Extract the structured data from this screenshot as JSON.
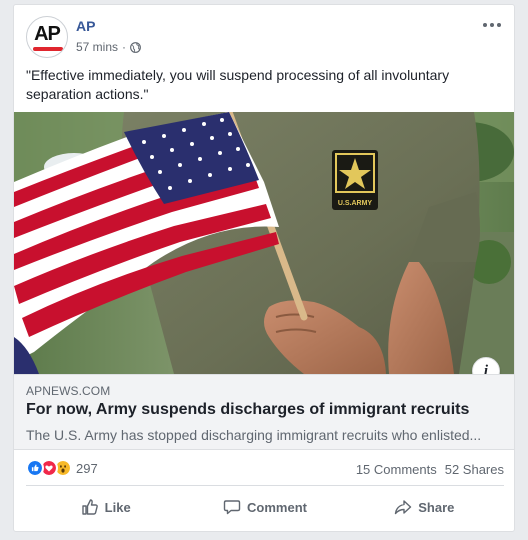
{
  "post": {
    "page_name": "AP",
    "avatar_text": "AP",
    "time": "57 mins",
    "separator": "·",
    "caption": "\"Effective immediately, you will suspend processing of all involuntary separation actions.\""
  },
  "link": {
    "domain": "APNEWS.COM",
    "headline": "For now, Army suspends discharges of immigrant recruits",
    "description": "The U.S. Army has stopped discharging immigrant recruits who enlisted..."
  },
  "stats": {
    "reaction_count": "297",
    "comments": "15 Comments",
    "shares": "52 Shares"
  },
  "actions": {
    "like": "Like",
    "comment": "Comment",
    "share": "Share"
  },
  "info_icon_text": "i",
  "patch": {
    "line1": "U.S.ARMY"
  },
  "colors": {
    "page_name": "#385898",
    "ap_red": "#e0262e",
    "like_blue": "#1877f2",
    "love_red": "#f0284a",
    "wow_yellow": "#f7b928",
    "shirt_olive": "#6d7358",
    "flag_red": "#c8102e",
    "flag_blue": "#2a2f6e"
  },
  "icons": [
    "globe-icon",
    "more-icon",
    "info-icon",
    "like-icon",
    "comment-icon",
    "share-icon",
    "like-reaction-icon",
    "love-reaction-icon",
    "wow-reaction-icon"
  ]
}
